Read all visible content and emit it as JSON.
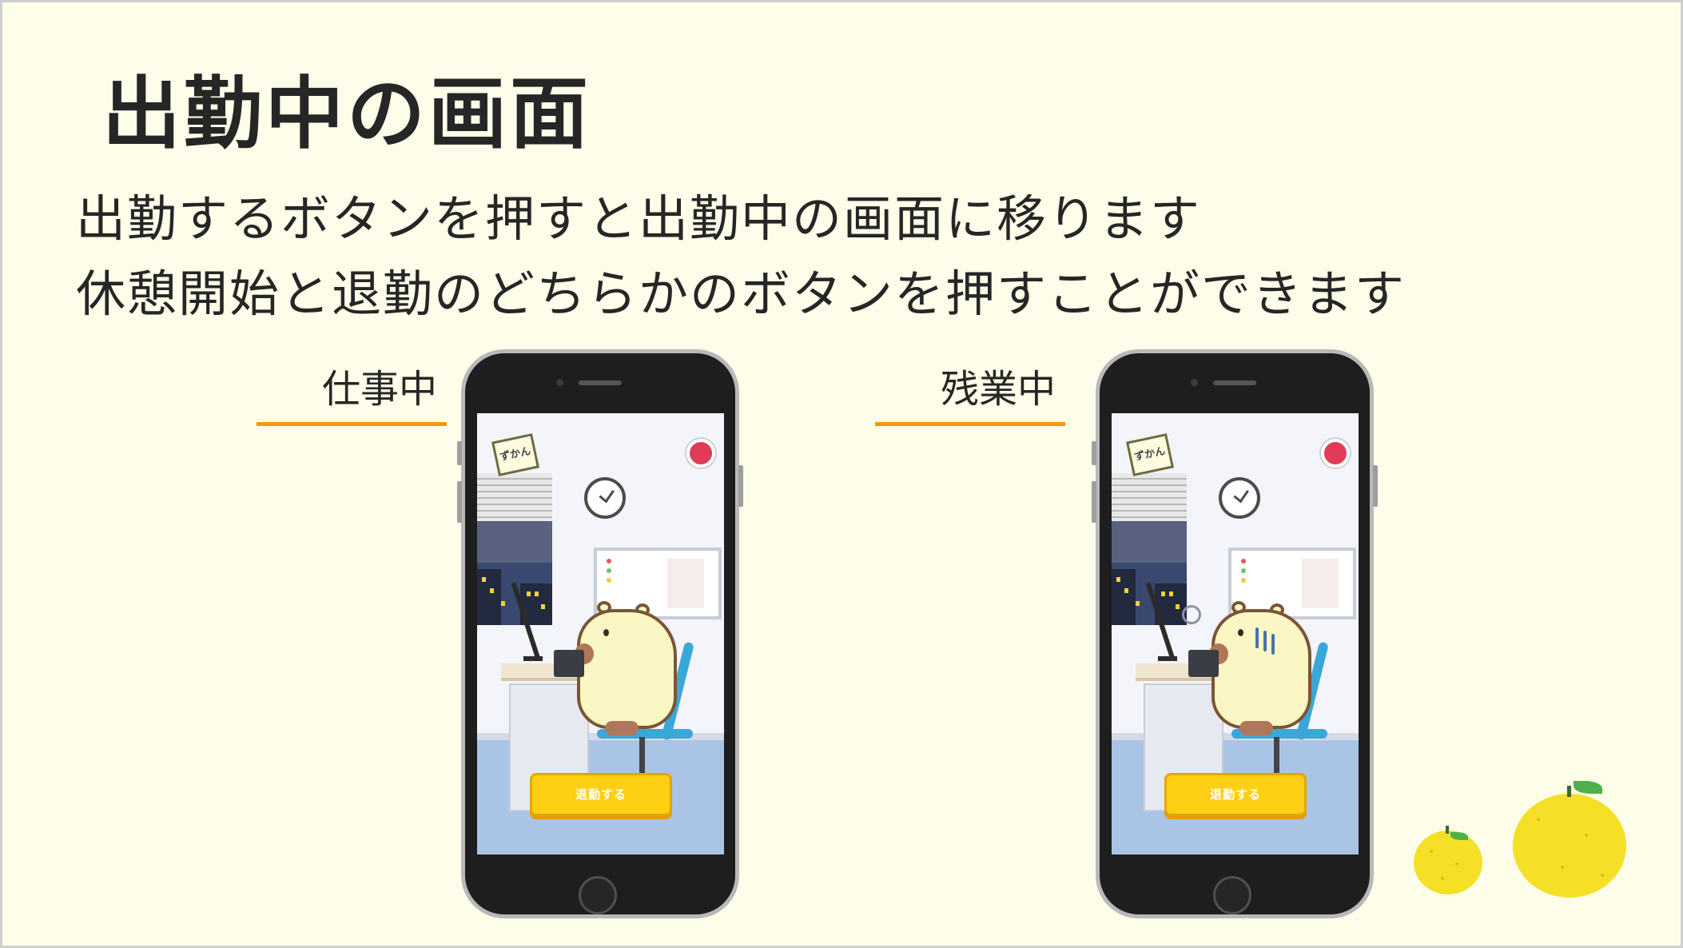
{
  "slide": {
    "title": "出勤中の画面",
    "description_line1": "出勤するボタンを押すと出勤中の画面に移ります",
    "description_line2": "休憩開始と退勤のどちらかのボタンを押すことができます"
  },
  "phones": [
    {
      "state_label": "仕事中",
      "zukan_label": "ずかん",
      "action_button": "退勤する"
    },
    {
      "state_label": "残業中",
      "zukan_label": "ずかん",
      "action_button": "退勤する"
    }
  ],
  "colors": {
    "background": "#fdfde9",
    "label_underline": "#f29a0f",
    "button": "#ffcf14"
  },
  "icons": [
    "zukan-book-icon",
    "record-icon",
    "wall-clock-icon",
    "yuzu-fruit-icon"
  ]
}
